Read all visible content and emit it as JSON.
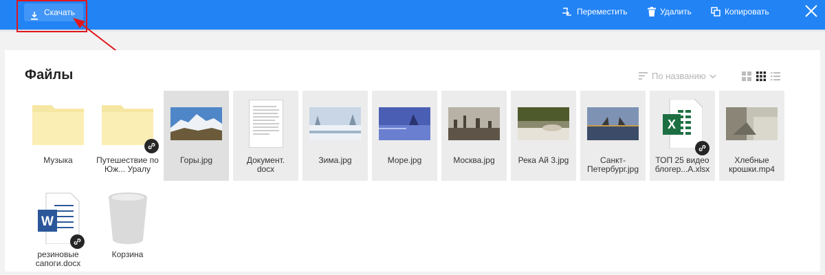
{
  "toolbar": {
    "download_label": "Скачать",
    "move_label": "Переместить",
    "delete_label": "Удалить",
    "copy_label": "Копировать"
  },
  "panel": {
    "title": "Файлы",
    "sort_label": "По названию"
  },
  "files": [
    {
      "name": "Музыка",
      "icon": "folder-icon"
    },
    {
      "name": "Путешествие по Юж... Уралу",
      "icon": "folder-icon",
      "shared": true
    },
    {
      "name": "Горы.jpg",
      "icon": "image-thumbnail",
      "selected": true
    },
    {
      "name": "Документ.\ndocx",
      "icon": "document-icon"
    },
    {
      "name": "Зима.jpg",
      "icon": "image-thumbnail"
    },
    {
      "name": "Море.jpg",
      "icon": "image-thumbnail"
    },
    {
      "name": "Москва.jpg",
      "icon": "image-thumbnail"
    },
    {
      "name": "Река Ай 3.jpg",
      "icon": "image-thumbnail"
    },
    {
      "name": "Санкт-Петербург.jpg",
      "icon": "image-thumbnail"
    },
    {
      "name": "ТОП 25 видео блогер...А.xlsx",
      "icon": "excel-icon",
      "shared": true
    },
    {
      "name": "Хлебные крошки.mp4",
      "icon": "video-thumbnail"
    },
    {
      "name": "резиновые сапоги.docx",
      "icon": "word-icon",
      "shared": true
    },
    {
      "name": "Корзина",
      "icon": "trash-icon"
    }
  ],
  "colors": {
    "accent": "#2283f5",
    "annotation": "#e0161b"
  }
}
